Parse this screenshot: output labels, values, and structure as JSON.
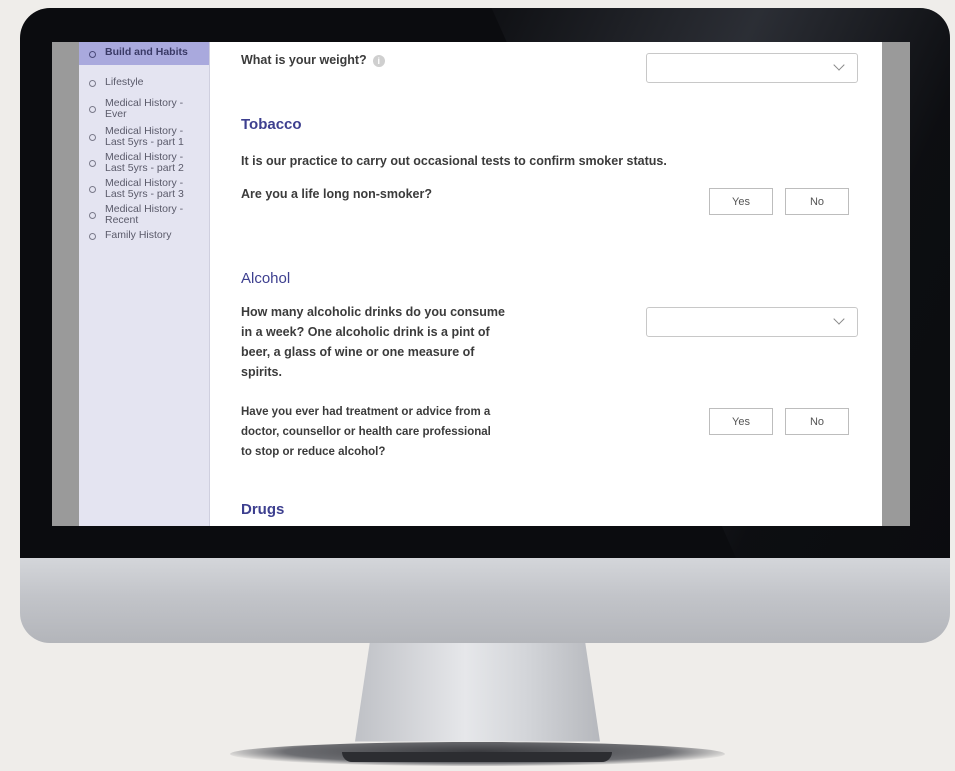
{
  "sidebar": {
    "items": [
      {
        "label": "Build and Habits",
        "active": true
      },
      {
        "label": "Lifestyle"
      },
      {
        "label": "Medical History - Ever"
      },
      {
        "label": "Medical History - Last 5yrs - part 1"
      },
      {
        "label": "Medical History - Last 5yrs - part 2"
      },
      {
        "label": "Medical History - Last 5yrs - part 3"
      },
      {
        "label": "Medical History - Recent"
      },
      {
        "label": "Family History"
      }
    ]
  },
  "weight": {
    "question": "What is your weight?",
    "info_icon": "i",
    "selected": ""
  },
  "tobacco": {
    "heading": "Tobacco",
    "note": "It is our practice to carry out occasional tests to confirm smoker status.",
    "question": "Are you a life long non-smoker?",
    "yes_label": "Yes",
    "no_label": "No"
  },
  "alcohol": {
    "heading": "Alcohol",
    "q1_line1": "How many alcoholic drinks do you consume",
    "q1_line2": "in a week? One alcoholic drink is a pint of",
    "q1_line3": "beer, a glass of wine or one measure of",
    "q1_line4": "spirits.",
    "q1_selected": "",
    "q2_line1": "Have you ever had treatment or advice from a",
    "q2_line2": "doctor, counsellor or health care professional",
    "q2_line3": "to stop or reduce alcohol?",
    "yes_label": "Yes",
    "no_label": "No"
  },
  "drugs": {
    "heading": "Drugs"
  },
  "colors": {
    "accent": "#3d3f8f",
    "sidebar_bg": "#e4e4f1",
    "sidebar_active": "#a9a9dd"
  }
}
